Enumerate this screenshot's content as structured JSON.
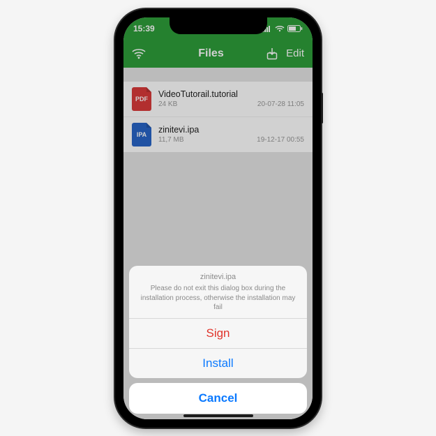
{
  "status": {
    "time": "15:39"
  },
  "nav": {
    "title": "Files",
    "edit": "Edit"
  },
  "files": [
    {
      "kind": "PDF",
      "name": "VideoTutorail.tutorial",
      "size": "24 KB",
      "date": "20-07-28 11:05"
    },
    {
      "kind": "IPA",
      "name": "zinitevi.ipa",
      "size": "11,7 MB",
      "date": "19-12-17 00:55"
    }
  ],
  "sheet": {
    "title": "zinitevi.ipa",
    "message": "Please do not exit this dialog box during the installation process, otherwise the installation may fail",
    "sign": "Sign",
    "install": "Install",
    "cancel": "Cancel"
  }
}
